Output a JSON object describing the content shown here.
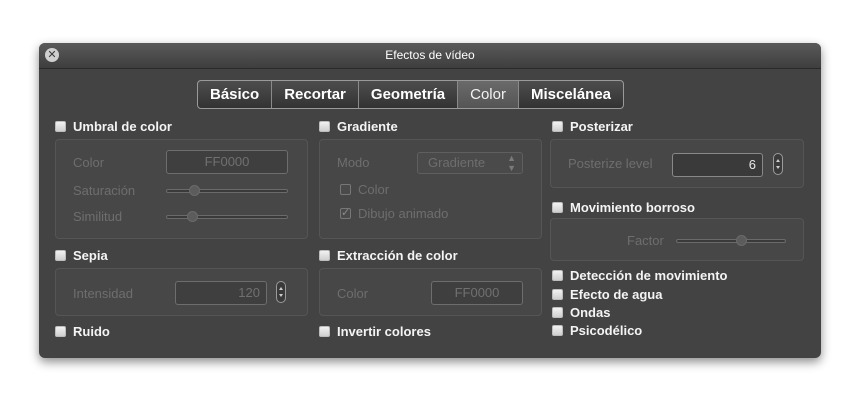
{
  "window": {
    "title": "Efectos de vídeo"
  },
  "tabs": [
    {
      "label": "Básico"
    },
    {
      "label": "Recortar"
    },
    {
      "label": "Geometría"
    },
    {
      "label": "Color"
    },
    {
      "label": "Miscelánea"
    }
  ],
  "selected_tab": "Color",
  "col1": {
    "umbral": {
      "label": "Umbral de color",
      "color_label": "Color",
      "color_value": "FF0000",
      "saturacion_label": "Saturación",
      "saturacion_level": 0.2,
      "similitud_label": "Similitud",
      "similitud_level": 0.18
    },
    "sepia": {
      "label": "Sepia",
      "intensidad_label": "Intensidad",
      "intensidad_value": "120"
    },
    "ruido": {
      "label": "Ruido"
    }
  },
  "col2": {
    "gradiente": {
      "label": "Gradiente",
      "modo_label": "Modo",
      "modo_value": "Gradiente",
      "color_check_label": "Color",
      "dibujo_label": "Dibujo animado",
      "dibujo_checked": true
    },
    "extraccion": {
      "label": "Extracción de color",
      "color_label": "Color",
      "color_value": "FF0000"
    },
    "invertir": {
      "label": "Invertir colores"
    }
  },
  "col3": {
    "posterizar": {
      "label": "Posterizar",
      "level_label": "Posterize level",
      "level_value": "6"
    },
    "movimiento_borroso": {
      "label": "Movimiento borroso",
      "factor_label": "Factor",
      "factor_level": 0.6
    },
    "deteccion": {
      "label": "Detección de movimiento"
    },
    "agua": {
      "label": "Efecto de agua"
    },
    "ondas": {
      "label": "Ondas"
    },
    "psicodelico": {
      "label": "Psicodélico"
    }
  },
  "icons": {
    "close": "close-icon",
    "stepper": "stepper-arrows-icon",
    "checkmark": "checkmark-icon"
  }
}
